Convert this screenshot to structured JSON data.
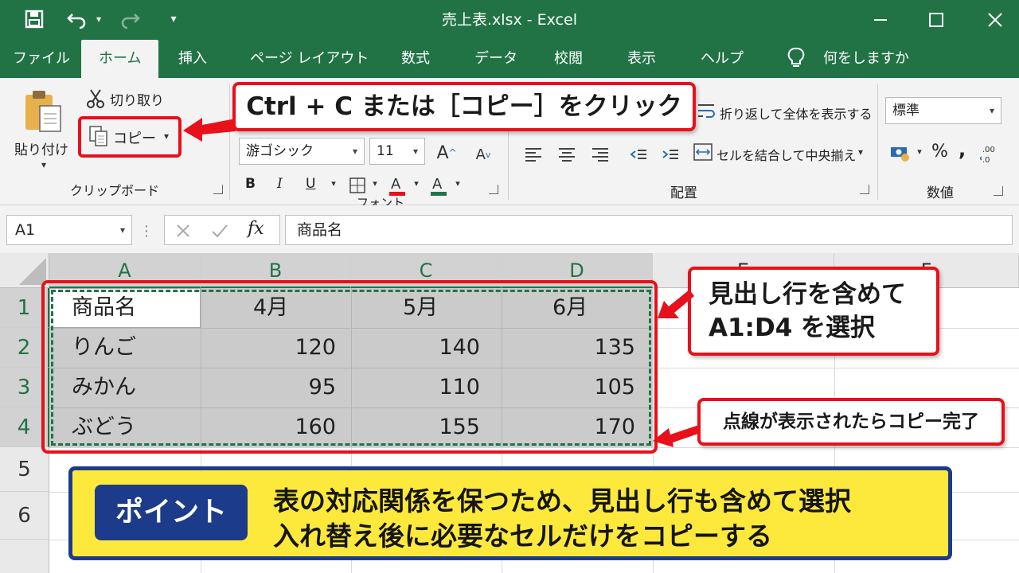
{
  "titlebar": {
    "title": "売上表.xlsx  -  Excel"
  },
  "tabs": [
    {
      "label": "ファイル",
      "active": false
    },
    {
      "label": "ホーム",
      "active": true
    },
    {
      "label": "挿入",
      "active": false
    },
    {
      "label": "ページ レイアウト",
      "active": false
    },
    {
      "label": "数式",
      "active": false
    },
    {
      "label": "データ",
      "active": false
    },
    {
      "label": "校閲",
      "active": false
    },
    {
      "label": "表示",
      "active": false
    },
    {
      "label": "ヘルプ",
      "active": false
    }
  ],
  "tell_me": {
    "label": "何をしますか"
  },
  "ribbon": {
    "clipboard": {
      "paste_label": "貼り付け",
      "cut_label": "切り取り",
      "copy_label": "コピー",
      "group_label": "クリップボード"
    },
    "font": {
      "font_name": "游ゴシック",
      "font_size": "11",
      "group_label": "フォント",
      "bold": "B",
      "italic": "I",
      "underline": "U"
    },
    "alignment": {
      "wrap_label": "折り返して全体を表示する",
      "merge_label": "セルを結合して中央揃え",
      "group_label": "配置"
    },
    "number": {
      "format": "標準",
      "percent": "%",
      "comma": ",",
      "group_label": "数値"
    }
  },
  "formula_bar": {
    "name_box": "A1",
    "fx": "fx",
    "value": "商品名"
  },
  "sheet": {
    "columns": [
      "A",
      "B",
      "C",
      "D",
      "E",
      "F"
    ],
    "rows": [
      "1",
      "2",
      "3",
      "4",
      "5",
      "6"
    ],
    "cells": [
      [
        "商品名",
        "4月",
        "5月",
        "6月"
      ],
      [
        "りんご",
        "120",
        "140",
        "135"
      ],
      [
        "みかん",
        "95",
        "110",
        "105"
      ],
      [
        "ぶどう",
        "160",
        "155",
        "170"
      ]
    ]
  },
  "callouts": {
    "copy": "Ctrl + C または［コピー］をクリック",
    "select_line1": "見出し行を含めて",
    "select_line2": "A1:D4 を選択",
    "done": "点線が表示されたらコピー完了"
  },
  "point": {
    "badge": "ポイント",
    "line1": "表の対応関係を保つため、見出し行も含めて選択",
    "line2": "入れ替え後に必要なセルだけをコピーする"
  },
  "colors": {
    "excel_green": "#217346",
    "highlight_red": "#e8101a",
    "banner_yellow": "#fde93c",
    "banner_navy": "#1c3b8a"
  }
}
